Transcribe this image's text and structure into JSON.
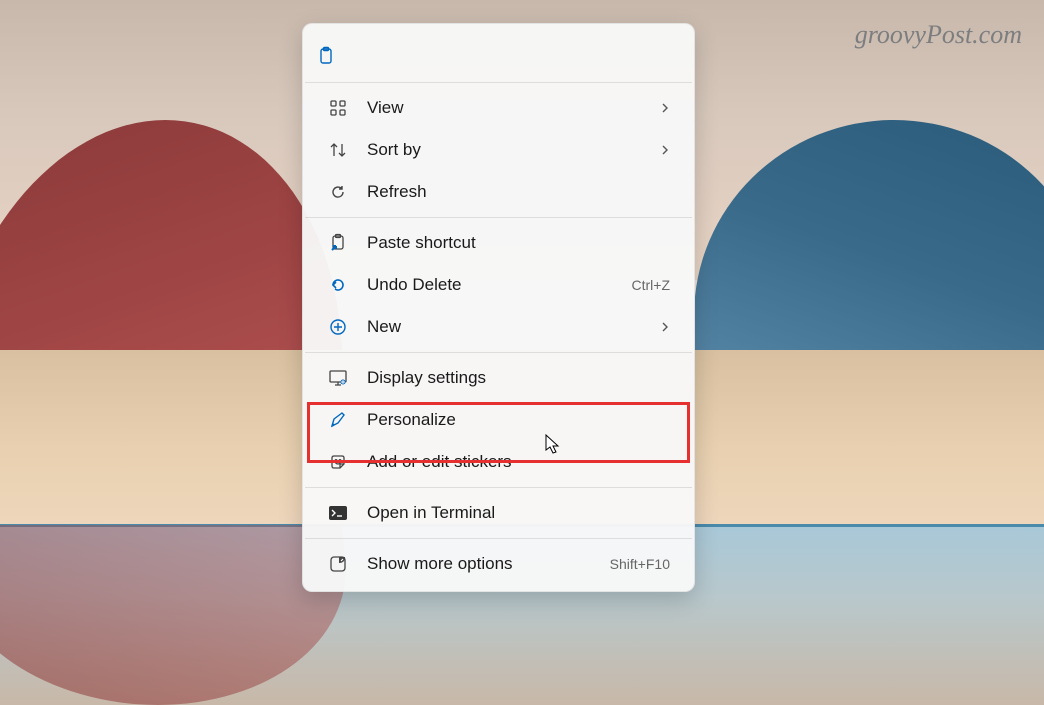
{
  "watermark": "groovyPost.com",
  "menu": {
    "view": {
      "label": "View",
      "has_submenu": true
    },
    "sortby": {
      "label": "Sort by",
      "has_submenu": true
    },
    "refresh": {
      "label": "Refresh"
    },
    "paste_shortcut": {
      "label": "Paste shortcut"
    },
    "undo_delete": {
      "label": "Undo Delete",
      "shortcut": "Ctrl+Z"
    },
    "new": {
      "label": "New",
      "has_submenu": true
    },
    "display_settings": {
      "label": "Display settings"
    },
    "personalize": {
      "label": "Personalize"
    },
    "stickers": {
      "label": "Add or edit stickers"
    },
    "terminal": {
      "label": "Open in Terminal"
    },
    "more_options": {
      "label": "Show more options",
      "shortcut": "Shift+F10"
    }
  }
}
